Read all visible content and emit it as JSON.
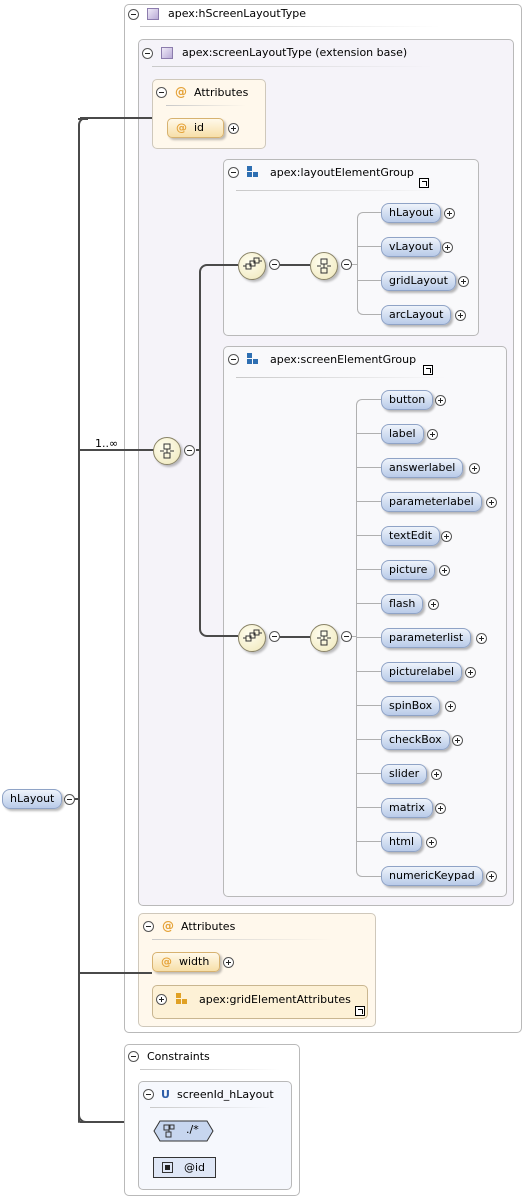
{
  "complex_type": {
    "label": "apex:hScreenLayoutType"
  },
  "extension": {
    "label": "apex:screenLayoutType (extension base)"
  },
  "attributes_top": {
    "title": "Attributes",
    "items": [
      "id"
    ]
  },
  "layout_group": {
    "label": "apex:layoutElementGroup",
    "items": [
      "hLayout",
      "vLayout",
      "gridLayout",
      "arcLayout"
    ]
  },
  "screen_group": {
    "label": "apex:screenElementGroup",
    "items": [
      "button",
      "label",
      "answerlabel",
      "parameterlabel",
      "textEdit",
      "picture",
      "flash",
      "parameterlist",
      "picturelabel",
      "spinBox",
      "checkBox",
      "slider",
      "matrix",
      "html",
      "numericKeypad"
    ]
  },
  "cardinality": "1..∞",
  "attributes_bottom": {
    "title": "Attributes",
    "items": [
      "width"
    ],
    "group": "apex:gridElementAttributes"
  },
  "constraints": {
    "title": "Constraints",
    "unique": {
      "icon": "U",
      "name": "screenId_hLayout",
      "selector": "./*",
      "field": "@id"
    }
  },
  "root": {
    "label": "hLayout"
  }
}
